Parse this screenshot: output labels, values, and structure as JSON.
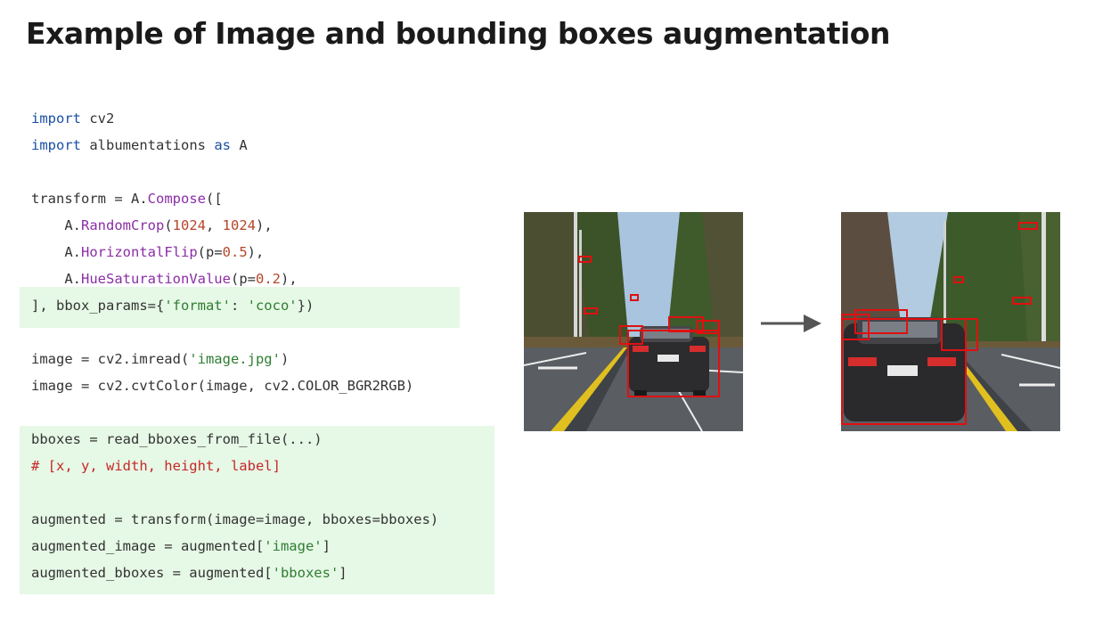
{
  "slide": {
    "title": "Example of Image and bounding boxes augmentation"
  },
  "code": {
    "l1": {
      "a": "import",
      "b": " cv2"
    },
    "l2": {
      "a": "import",
      "b": " albumentations ",
      "c": "as",
      "d": " A"
    },
    "l4": {
      "a": "transform = A.",
      "b": "Compose",
      "c": "(["
    },
    "l5": {
      "a": "    A.",
      "b": "RandomCrop",
      "c": "(",
      "d": "1024",
      "e": ", ",
      "f": "1024",
      "g": "),"
    },
    "l6": {
      "a": "    A.",
      "b": "HorizontalFlip",
      "c": "(p=",
      "d": "0.5",
      "e": "),"
    },
    "l7": {
      "a": "    A.",
      "b": "HueSaturationValue",
      "c": "(p=",
      "d": "0.2",
      "e": "),"
    },
    "l8": {
      "a": "], bbox_params={",
      "b": "'format'",
      "c": ": ",
      "d": "'coco'",
      "e": "})"
    },
    "l10": {
      "a": "image = cv2.imread(",
      "b": "'image.jpg'",
      "c": ")"
    },
    "l11": {
      "a": "image = cv2.cvtColor(image, cv2.COLOR_BGR2RGB)"
    },
    "l13": {
      "a": "bboxes = read_bboxes_from_file(...)"
    },
    "l14": {
      "a": "# [x, y, width, height, label]"
    },
    "l16": {
      "a": "augmented = transform(image=image, bboxes=bboxes)"
    },
    "l17": {
      "a": "augmented_image = augmented[",
      "b": "'image'",
      "c": "]"
    },
    "l18": {
      "a": "augmented_bboxes = augmented[",
      "b": "'bboxes'",
      "c": "]"
    }
  },
  "images": {
    "original": {
      "content": "road-with-car-photo"
    },
    "augmented": {
      "content": "road-with-car-photo-flipped"
    }
  },
  "icons": {
    "arrow": "right-arrow-icon"
  },
  "colors": {
    "highlight": "#e6f8e6",
    "keyword": "#1a4fa3",
    "function": "#8a2ea5",
    "number": "#b5462a",
    "string": "#2f7d32",
    "comment": "#c62828",
    "bbox": "#e01010",
    "arrow": "#555555"
  }
}
